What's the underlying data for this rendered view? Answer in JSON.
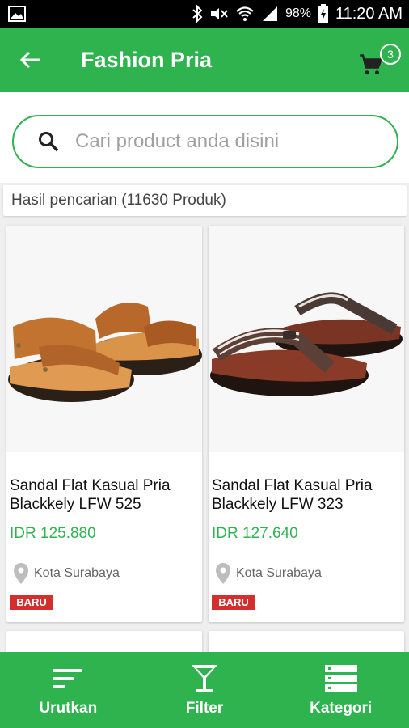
{
  "status_bar": {
    "battery_percent": "98%",
    "time": "11:20 AM"
  },
  "app_bar": {
    "title": "Fashion Pria",
    "cart_count": "3"
  },
  "search": {
    "placeholder": "Cari product anda disini"
  },
  "results": {
    "summary": "Hasil pencarian (11630 Produk)"
  },
  "products": [
    {
      "name": "Sandal Flat Kasual Pria Blackkely LFW 525",
      "price": "IDR 125.880",
      "location": "Kota Surabaya",
      "badge": "BARU"
    },
    {
      "name": "Sandal Flat Kasual Pria Blackkely LFW 323",
      "price": "IDR 127.640",
      "location": "Kota Surabaya",
      "badge": "BARU"
    }
  ],
  "bottom_nav": {
    "items": [
      {
        "label": "Urutkan",
        "icon": "sort-icon"
      },
      {
        "label": "Filter",
        "icon": "filter-icon"
      },
      {
        "label": "Kategori",
        "icon": "category-icon"
      }
    ]
  },
  "colors": {
    "primary": "#2eb34f",
    "badge": "#d32f2f"
  }
}
